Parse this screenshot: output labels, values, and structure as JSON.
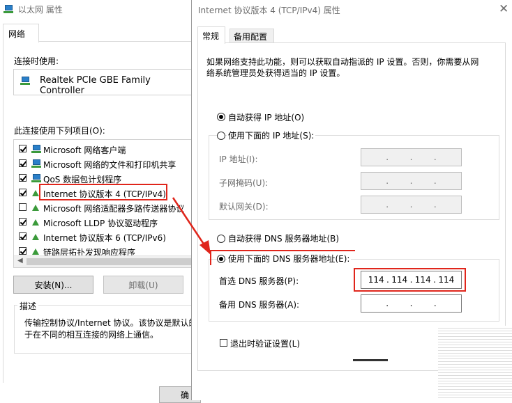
{
  "left_window": {
    "title": "以太网 属性",
    "tab": "网络",
    "connect_using_label": "连接时使用:",
    "adapter_name": "Realtek PCIe GBE Family Controller",
    "items_label": "此连接使用下列项目(O):",
    "items": [
      {
        "label": "Microsoft 网络客户端",
        "checked": true,
        "icon": "network-client-icon"
      },
      {
        "label": "Microsoft 网络的文件和打印机共享",
        "checked": true,
        "icon": "file-share-icon"
      },
      {
        "label": "QoS 数据包计划程序",
        "checked": true,
        "icon": "qos-icon"
      },
      {
        "label": "Internet 协议版本 4 (TCP/IPv4)",
        "checked": true,
        "icon": "protocol-icon"
      },
      {
        "label": "Microsoft 网络适配器多路传送器协议",
        "checked": false,
        "icon": "protocol-icon"
      },
      {
        "label": "Microsoft LLDP 协议驱动程序",
        "checked": true,
        "icon": "protocol-icon"
      },
      {
        "label": "Internet 协议版本 6 (TCP/IPv6)",
        "checked": true,
        "icon": "protocol-icon"
      },
      {
        "label": "链路层拓扑发现响应程序",
        "checked": true,
        "icon": "protocol-icon"
      }
    ],
    "install_button": "安装(N)...",
    "uninstall_button": "卸载(U)",
    "description_label": "描述",
    "description_text_1": "传输控制协议/Internet 协议。该协议是默认的",
    "description_text_2": "于在不同的相互连接的网络上通信。",
    "ok_button": "确"
  },
  "right_window": {
    "title": "Internet 协议版本 4 (TCP/IPv4) 属性",
    "tabs": [
      "常规",
      "备用配置"
    ],
    "intro_line1": "如果网络支持此功能，则可以获取自动指派的 IP 设置。否则，你需要从网",
    "intro_line2": "络系统管理员处获得适当的 IP 设置。",
    "auto_ip": "自动获得 IP 地址(O)",
    "manual_ip": "使用下面的 IP 地址(S):",
    "ip_label": "IP 地址(I):",
    "mask_label": "子网掩码(U):",
    "gateway_label": "默认网关(D):",
    "auto_dns": "自动获得 DNS 服务器地址(B)",
    "manual_dns": "使用下面的 DNS 服务器地址(E):",
    "preferred_dns_label": "首选 DNS 服务器(P):",
    "preferred_dns": [
      "114",
      "114",
      "114",
      "114"
    ],
    "alternate_dns_label": "备用 DNS 服务器(A):",
    "validate_label": "退出时验证设置(L)",
    "highlight_color": "#e0251b"
  }
}
